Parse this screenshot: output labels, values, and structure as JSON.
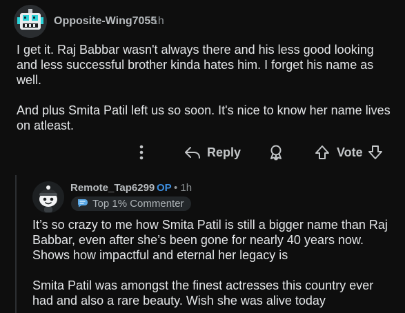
{
  "comment": {
    "author": "Opposite-Wing7055",
    "time": "1h",
    "paragraphs": [
      "I get it. Raj Babbar wasn't always there and his less good looking and less successful brother kinda hates him. I forget his name as well.",
      "And plus Smita Patil left us so soon. It's nice to know her name lives on atleast."
    ],
    "avatar_icon": "robot-avatar-icon"
  },
  "actions": {
    "more_icon": "more-vertical-icon",
    "reply_label": "Reply",
    "award_icon": "award-icon",
    "vote_label": "Vote",
    "upvote_icon": "upvote-arrow-icon",
    "downvote_icon": "downvote-arrow-icon"
  },
  "reply": {
    "author": "Remote_Tap6299",
    "op_label": "OP",
    "time": "• 1h",
    "flair": "Top 1% Commenter",
    "flair_icon": "commenter-badge-icon",
    "avatar_icon": "snoo-avatar-icon",
    "paragraphs": [
      "It’s so crazy to me how Smita Patil is still a bigger name than Raj Babbar, even after she’s been gone for nearly 40 years now. Shows how impactful and eternal her legacy is",
      "Smita Patil was amongst the finest actresses this country ever had and also a rare beauty. Wish she was alive today"
    ]
  },
  "colors": {
    "background": "#0e0e0e",
    "text": "#e4e6e8",
    "username": "#b8bcbf",
    "op": "#3d8fe0",
    "flair_bg": "#23272a"
  }
}
